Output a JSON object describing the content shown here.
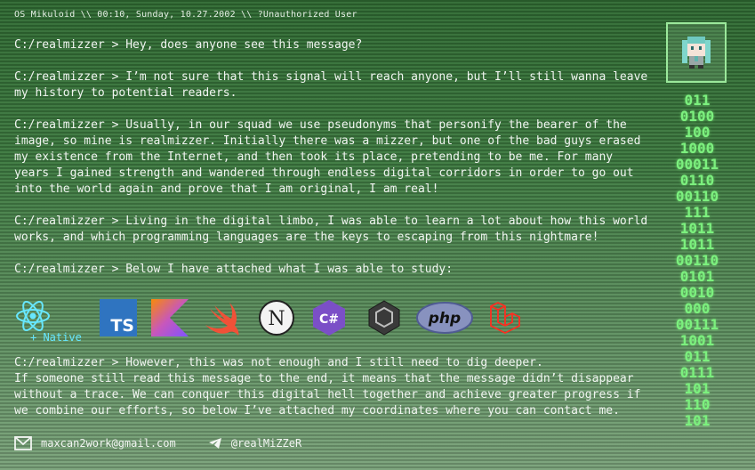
{
  "status_bar": {
    "text": "OS Mikuloid \\\\ 00:10, Sunday, 10.27.2002 \\\\ ?Unauthorized User"
  },
  "terminal": {
    "lines": [
      "C:/realmizzer > Hey, does anyone see this message?",
      "C:/realmizzer > I’m not sure that this signal will reach anyone, but I’ll still wanna leave my history to potential readers.",
      "C:/realmizzer > Usually, in our squad we use pseudonyms that personify the bearer of the image, so mine is realmizzer. Initially there was a mizzer, but one of the bad guys erased my existence from the Internet, and then took its place, pretending to be me. For many years I gained strength and wandered through endless digital corridors in order to go out into the world again and prove that I am original, I am real!",
      "C:/realmizzer > Living in the digital limbo, I was able to learn a lot about how this world works, and which programming languages are the keys to escaping from this nightmare!",
      "C:/realmizzer > Below I have attached what I was able to study:"
    ],
    "after_icons": "C:/realmizzer > However, this was not enough and I still need to dig deeper.\nIf someone still read this message to the end, it means that the message didn’t disappear without a trace. We can conquer this digital hell together and achieve greater progress if we combine our efforts, so below I’ve attached my coordinates where you can contact me."
  },
  "tech_icons": {
    "react_sub": "+ Native",
    "ts_text": "TS",
    "csharp_text": "C#",
    "php_text": "php",
    "nuxt_text": "N",
    "names": [
      "react-icon",
      "typescript-icon",
      "kotlin-icon",
      "swift-icon",
      "next-icon",
      "csharp-icon",
      "unity-icon",
      "php-icon",
      "laravel-icon"
    ]
  },
  "contacts": {
    "email": "maxcan2work@gmail.com",
    "telegram": "@realMiZZeR"
  },
  "binary_column": [
    "011",
    "0100",
    "100",
    "1000",
    "00011",
    "0110",
    "00110",
    "111",
    "1011",
    "1011",
    "00110",
    "0101",
    "0010",
    "000",
    "00111",
    "1001",
    "011",
    "0111",
    "101",
    "110",
    "101"
  ],
  "colors": {
    "accent": "#7cf07e",
    "cyan": "#67e7ff"
  }
}
